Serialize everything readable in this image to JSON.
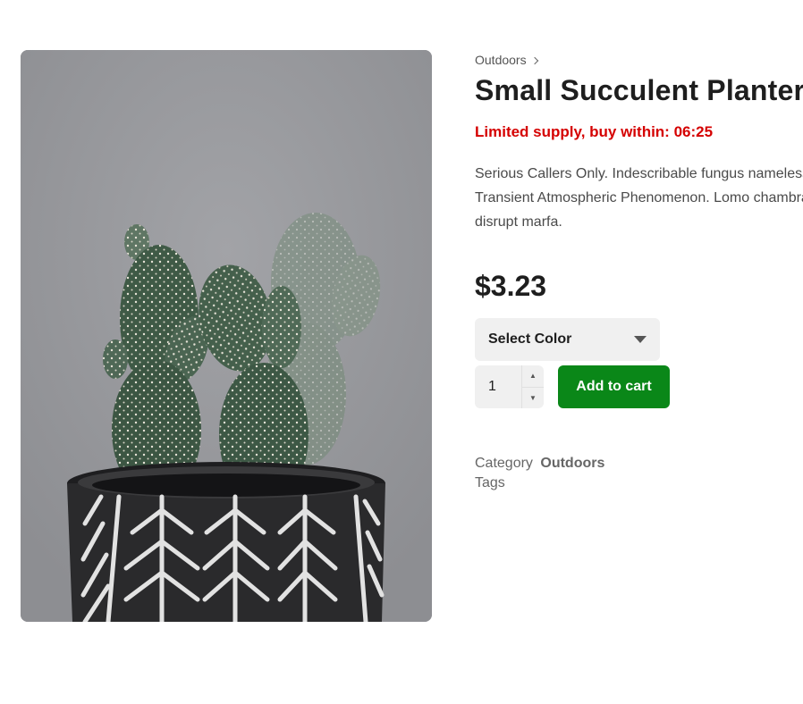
{
  "product": {
    "breadcrumb": "Outdoors",
    "title": "Small Succulent Planter Pot",
    "urgency": "Limited supply, buy within: 06:25",
    "description_lines": [
      "Serious Callers Only. Indescribable fungus nameless",
      "Transient Atmospheric Phenomenon. Lomo chambray",
      "disrupt marfa."
    ],
    "price": "$3.23",
    "variation_label": "Select Color",
    "quantity": "1",
    "add_to_cart": "Add to cart",
    "category_label": "Category",
    "category_value": "Outdoors",
    "tags_label": "Tags"
  },
  "colors": {
    "urgency": "#d50000",
    "button": "#0a8718"
  }
}
